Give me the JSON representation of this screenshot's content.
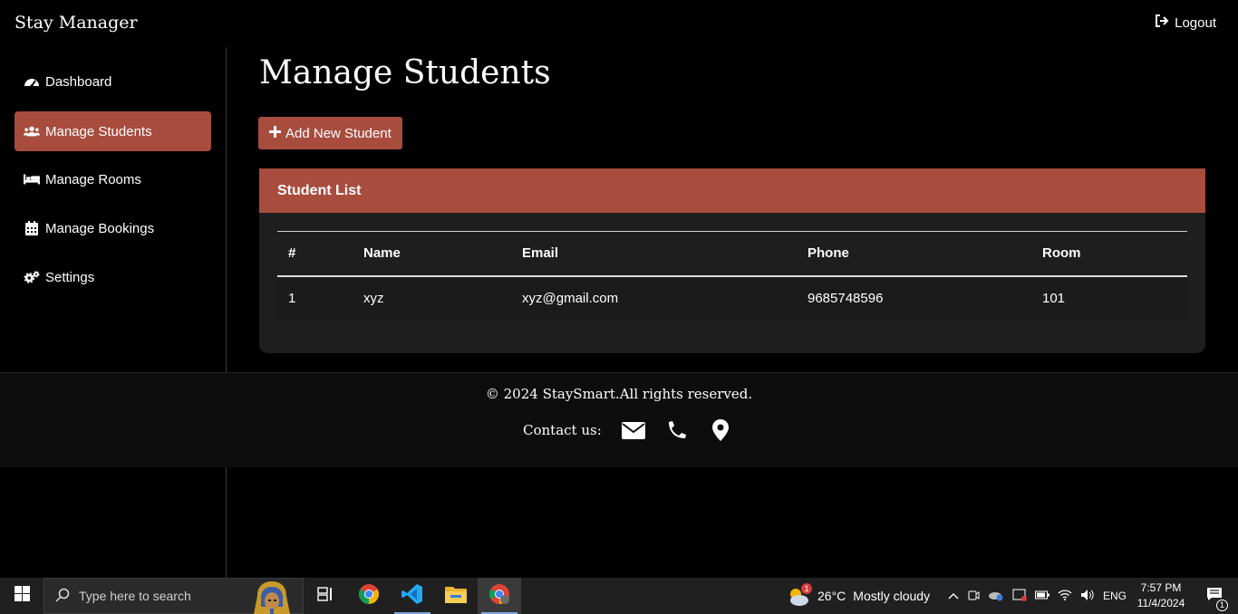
{
  "app": {
    "brand": "Stay Manager",
    "logout_label": "Logout"
  },
  "sidebar": {
    "items": [
      {
        "label": "Dashboard",
        "icon": "dashboard-icon"
      },
      {
        "label": "Manage Students",
        "icon": "users-icon",
        "active": true
      },
      {
        "label": "Manage Rooms",
        "icon": "bed-icon"
      },
      {
        "label": "Manage Bookings",
        "icon": "calendar-icon"
      },
      {
        "label": "Settings",
        "icon": "cogs-icon"
      }
    ]
  },
  "main": {
    "title": "Manage Students",
    "add_button_label": "Add New Student",
    "card_title": "Student List",
    "table": {
      "headers": [
        "#",
        "Name",
        "Email",
        "Phone",
        "Room"
      ],
      "rows": [
        [
          "1",
          "xyz",
          "xyz@gmail.com",
          "9685748596",
          "101"
        ]
      ]
    }
  },
  "footer": {
    "copyright": "© 2024 StaySmart.All rights reserved.",
    "contact_label": "Contact us:",
    "contact_icons": [
      "envelope-icon",
      "phone-icon",
      "map-marker-icon"
    ]
  },
  "taskbar": {
    "search_placeholder": "Type here to search",
    "weather_badge": "1",
    "temperature": "26°C",
    "weather_text": "Mostly cloudy",
    "language": "ENG",
    "time": "7:57 PM",
    "date": "11/4/2024",
    "notification_count": "1"
  },
  "colors": {
    "accent": "#a84c3e",
    "background": "#000000",
    "card": "#1e1e1e"
  }
}
